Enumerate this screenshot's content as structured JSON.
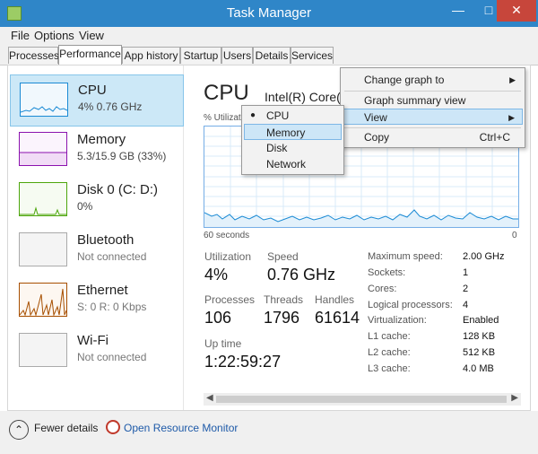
{
  "window": {
    "title": "Task Manager"
  },
  "menu": {
    "file": "File",
    "options": "Options",
    "view": "View"
  },
  "tabs": [
    "Processes",
    "Performance",
    "App history",
    "Startup",
    "Users",
    "Details",
    "Services"
  ],
  "resources": [
    {
      "name": "CPU",
      "sub": "4%  0.76 GHz"
    },
    {
      "name": "Memory",
      "sub": "5.3/15.9 GB (33%)"
    },
    {
      "name": "Disk 0 (C: D:)",
      "sub": "0%"
    },
    {
      "name": "Bluetooth",
      "sub": "Not connected"
    },
    {
      "name": "Ethernet",
      "sub": "S: 0  R: 0 Kbps"
    },
    {
      "name": "Wi-Fi",
      "sub": "Not connected"
    }
  ],
  "header": {
    "title": "CPU",
    "model": "Intel(R) Core("
  },
  "graph": {
    "label": "% Utilizat",
    "left_axis": "60 seconds",
    "right_axis": "0"
  },
  "stats": {
    "utilization_label": "Utilization",
    "utilization_value": "4%",
    "speed_label": "Speed",
    "speed_value": "0.76 GHz",
    "processes_label": "Processes",
    "processes_value": "106",
    "threads_label": "Threads",
    "threads_value": "1796",
    "handles_label": "Handles",
    "handles_value": "61614",
    "uptime_label": "Up time",
    "uptime_value": "1:22:59:27"
  },
  "specs": [
    {
      "label": "Maximum speed:",
      "value": "2.00 GHz"
    },
    {
      "label": "Sockets:",
      "value": "1"
    },
    {
      "label": "Cores:",
      "value": "2"
    },
    {
      "label": "Logical processors:",
      "value": "4"
    },
    {
      "label": "Virtualization:",
      "value": "Enabled"
    },
    {
      "label": "L1 cache:",
      "value": "128 KB"
    },
    {
      "label": "L2 cache:",
      "value": "512 KB"
    },
    {
      "label": "L3 cache:",
      "value": "4.0 MB"
    }
  ],
  "context_menu": {
    "change_graph_to": "Change graph to",
    "graph_summary_view": "Graph summary view",
    "view": "View",
    "copy": "Copy",
    "copy_shortcut": "Ctrl+C"
  },
  "submenu": [
    "CPU",
    "Memory",
    "Disk",
    "Network"
  ],
  "footer": {
    "fewer_details": "Fewer details",
    "open_resource_monitor": "Open Resource Monitor"
  },
  "colors": {
    "titlebar": "#2f86c8",
    "cpu_accent": "#1a8ad4",
    "memory_accent": "#8b12ae",
    "disk_accent": "#4da60c",
    "ethernet_accent": "#a74f01"
  }
}
